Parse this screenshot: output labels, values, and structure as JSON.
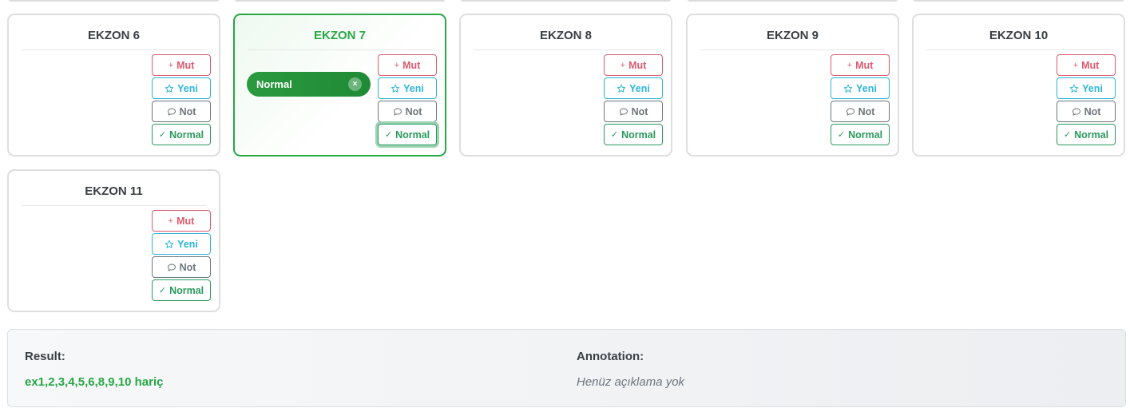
{
  "cards": [
    {
      "title": "EKZON 6"
    },
    {
      "title": "EKZON 7",
      "selection": "Normal"
    },
    {
      "title": "EKZON 8"
    },
    {
      "title": "EKZON 9"
    },
    {
      "title": "EKZON 10"
    },
    {
      "title": "EKZON 11"
    }
  ],
  "buttons": {
    "mut": "Mut",
    "yeni": "Yeni",
    "not": "Not",
    "normal": "Normal"
  },
  "icons": {
    "mut": "plus-icon",
    "yeni": "star-icon",
    "not": "comment-icon",
    "normal": "check-icon",
    "pill_close": "close-icon"
  },
  "footer": {
    "result_label": "Result:",
    "result_value": "ex1,2,3,4,5,6,8,9,10 hariç",
    "annotation_label": "Annotation:",
    "annotation_value": "Henüz açıklama yok"
  },
  "colors": {
    "accent": "#28a745",
    "mut": "#dc5a6e",
    "yeni": "#2bb5d6",
    "not": "#6c757d",
    "normal": "#2a9a5c"
  }
}
